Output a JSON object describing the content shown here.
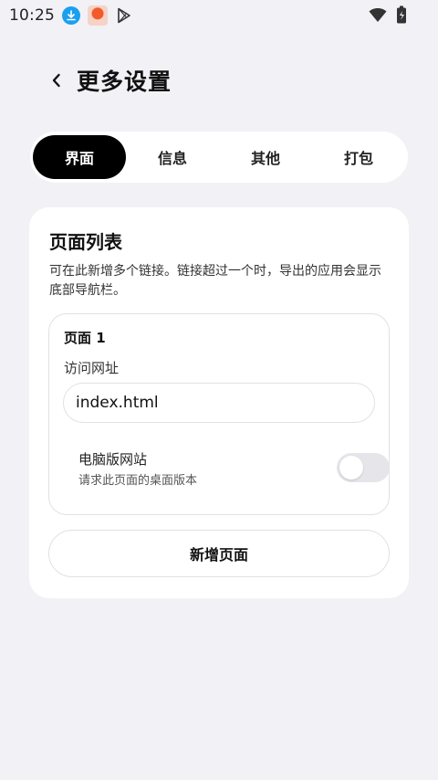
{
  "status_bar": {
    "time": "10:25",
    "icons_left": [
      "download-icon",
      "app-notification-icon",
      "play-store-icon"
    ],
    "icons_right": [
      "wifi-icon",
      "battery-icon"
    ]
  },
  "header": {
    "back_icon": "chevron-left-icon",
    "title": "更多设置"
  },
  "tabs": [
    {
      "label": "界面",
      "active": true
    },
    {
      "label": "信息",
      "active": false
    },
    {
      "label": "其他",
      "active": false
    },
    {
      "label": "打包",
      "active": false
    }
  ],
  "page_list": {
    "title": "页面列表",
    "description": "可在此新增多个链接。链接超过一个时，导出的应用会显示底部导航栏。",
    "pages": [
      {
        "name": "页面 1",
        "url_label": "访问网址",
        "url_value": "index.html",
        "desktop_title": "电脑版网站",
        "desktop_sub": "请求此页面的桌面版本",
        "desktop_enabled": false
      }
    ],
    "add_button_label": "新增页面"
  },
  "colors": {
    "background": "#f2f1f6",
    "card": "#ffffff",
    "active_tab": "#000000",
    "download_icon": "#1aa0ef",
    "toggle_off": "#e6e5ea"
  }
}
